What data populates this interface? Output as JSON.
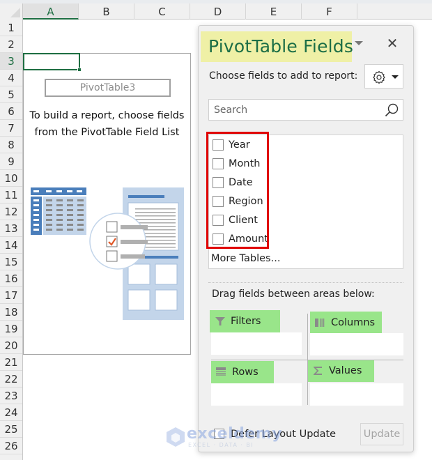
{
  "sheet": {
    "columns": [
      "A",
      "B",
      "C",
      "D",
      "E",
      "F"
    ],
    "active_column": "A",
    "rows": [
      "1",
      "2",
      "3",
      "4",
      "5",
      "6",
      "7",
      "8",
      "9",
      "10",
      "11",
      "12",
      "13",
      "14",
      "15",
      "16",
      "17",
      "18",
      "19",
      "20",
      "21",
      "22",
      "23",
      "24",
      "25",
      "26"
    ],
    "active_row": "3",
    "selected_cell": "A3"
  },
  "pivot_placeholder": {
    "name": "PivotTable3",
    "message_line1": "To build a report, choose fields",
    "message_line2": "from the PivotTable Field List"
  },
  "panel": {
    "title": "PivotTable Fields",
    "title_highlight_color": "#eff0a6",
    "title_color": "#1c6e46",
    "choose_label": "Choose fields to add to report:",
    "settings_icon": "gear-icon",
    "close_icon": "close-icon",
    "search": {
      "placeholder": "Search",
      "value": "",
      "icon": "search-icon"
    },
    "fields": [
      {
        "label": "Year",
        "checked": false
      },
      {
        "label": "Month",
        "checked": false
      },
      {
        "label": "Date",
        "checked": false
      },
      {
        "label": "Region",
        "checked": false
      },
      {
        "label": "Client",
        "checked": false
      },
      {
        "label": "Amount",
        "checked": false
      }
    ],
    "fields_highlight_color": "#e00000",
    "more_tables": "More Tables...",
    "drag_label": "Drag fields between areas below:",
    "areas": {
      "filters": {
        "label": "Filters",
        "icon": "filter-icon"
      },
      "columns": {
        "label": "Columns",
        "icon": "columns-icon"
      },
      "rows": {
        "label": "Rows",
        "icon": "rows-icon"
      },
      "values": {
        "label": "Values",
        "icon": "sigma-icon"
      }
    },
    "area_highlight_color": "#99e58a",
    "defer_label": "Defer Layout Update",
    "defer_checked": false,
    "update_label": "Update"
  },
  "watermark": {
    "brand": "exceldemy",
    "tagline": "EXCEL · DATA · BI"
  }
}
